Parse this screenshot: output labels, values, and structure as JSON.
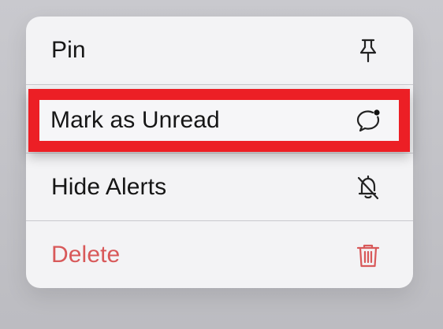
{
  "menu": {
    "items": [
      {
        "label": "Pin",
        "icon": "pin-icon"
      },
      {
        "label": "Mark as Unread",
        "icon": "message-unread-icon",
        "highlighted": true
      },
      {
        "label": "Hide Alerts",
        "icon": "bell-slash-icon"
      },
      {
        "label": "Delete",
        "icon": "trash-icon",
        "destructive": true
      }
    ]
  },
  "colors": {
    "highlight_border": "#ec1f25",
    "destructive": "#d8595a",
    "menu_background": "#f3f3f5",
    "backdrop": "#c4c4c9"
  }
}
